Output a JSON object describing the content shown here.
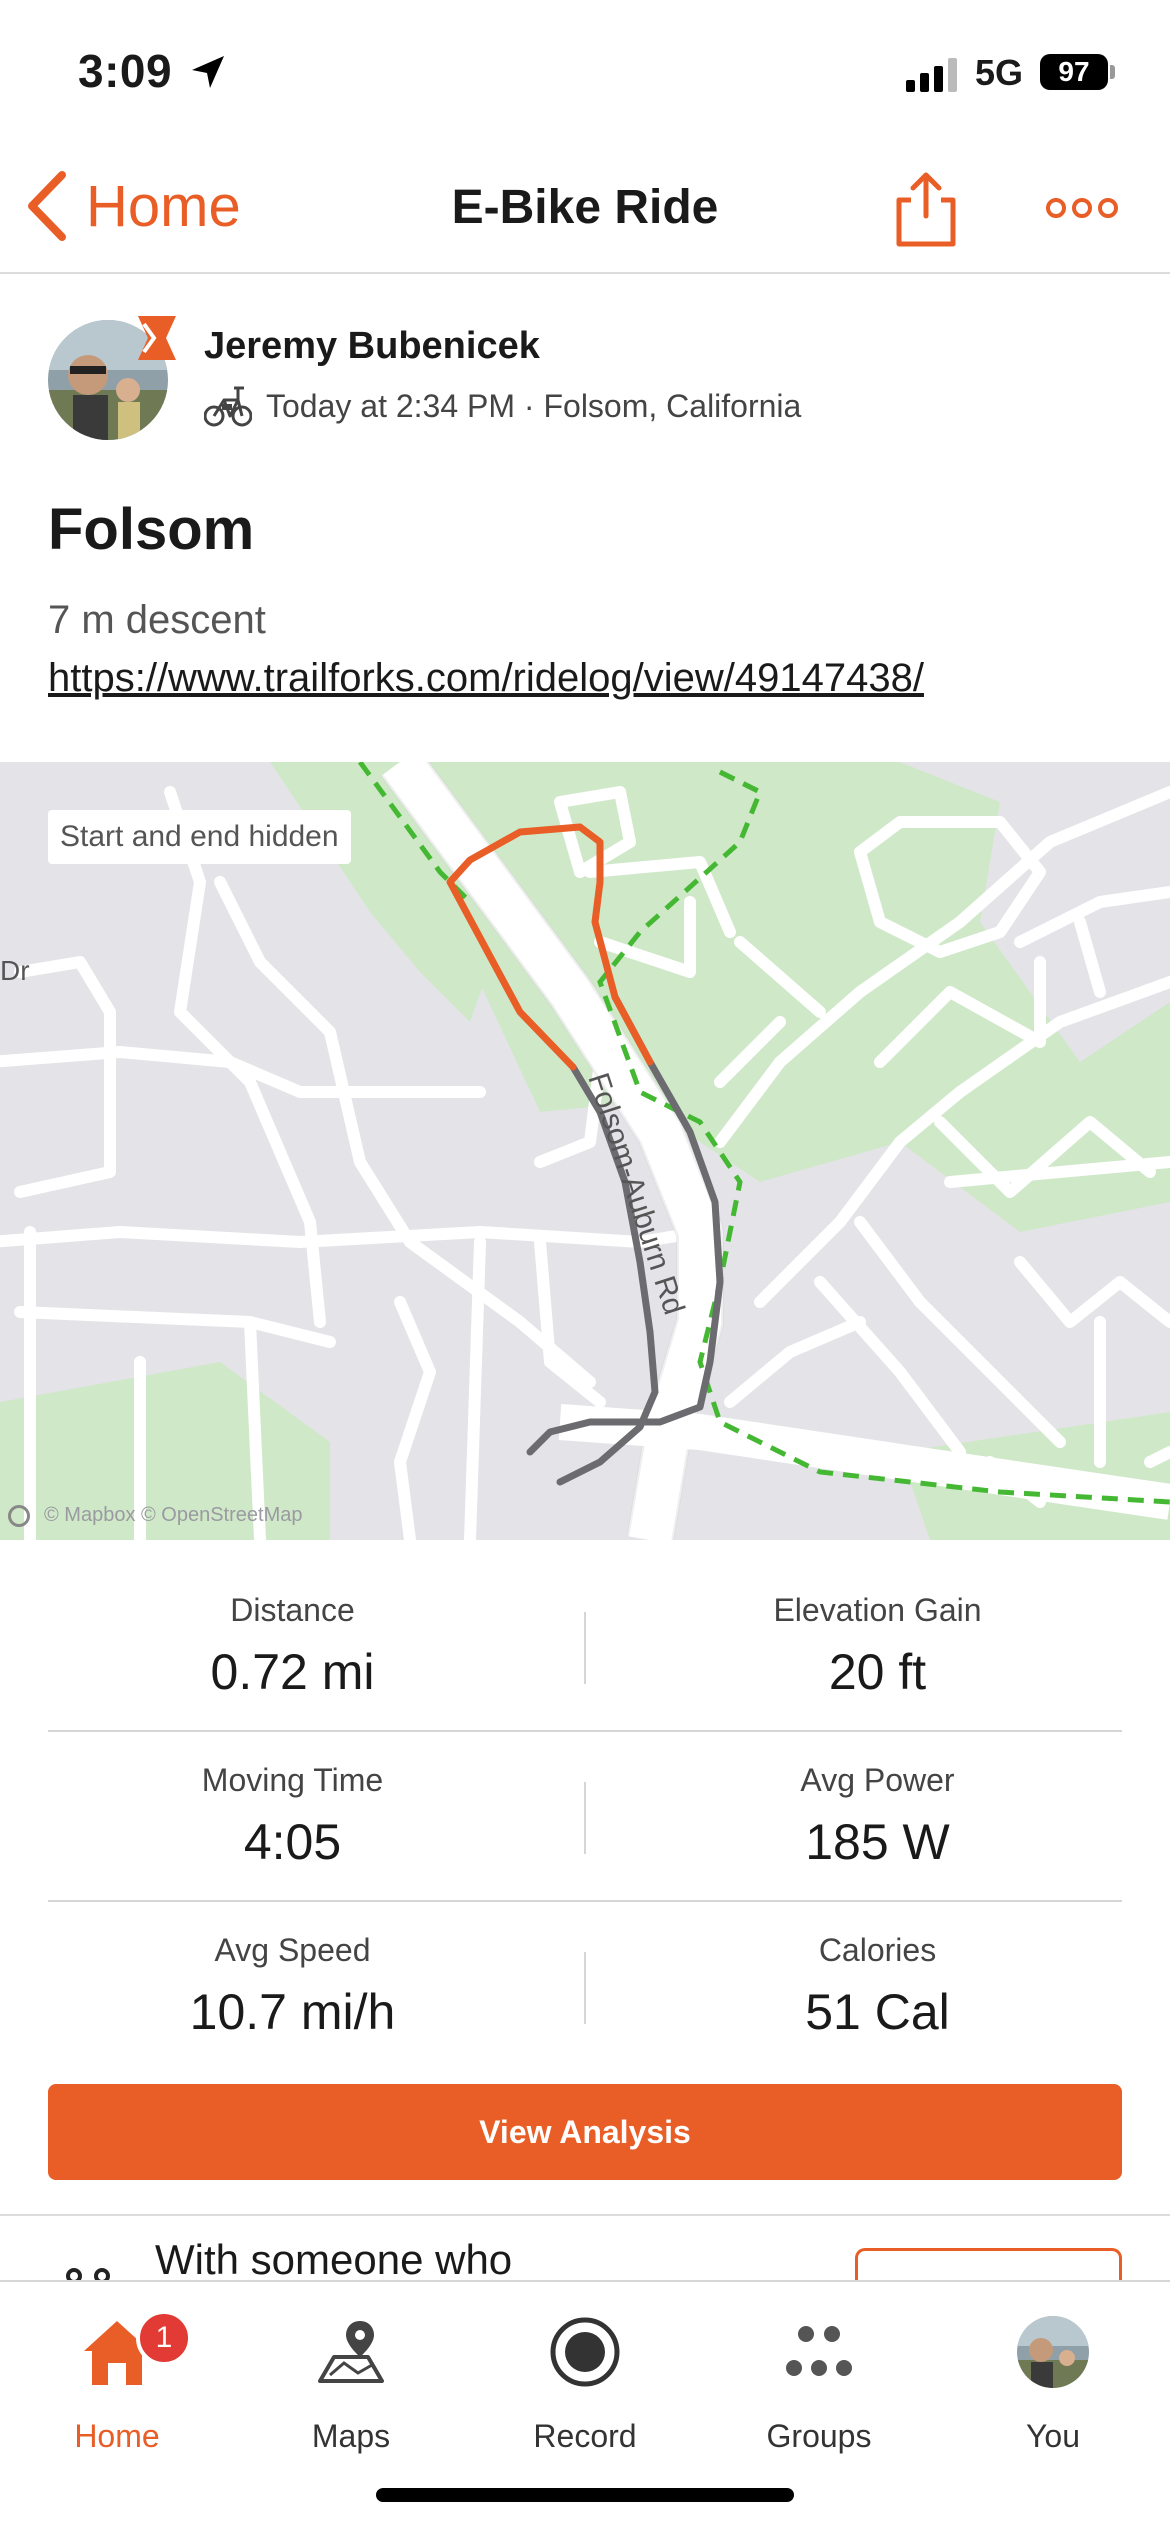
{
  "status_bar": {
    "time": "3:09",
    "network": "5G",
    "battery": "97"
  },
  "header": {
    "back_label": "Home",
    "title": "E-Bike Ride"
  },
  "athlete": {
    "name": "Jeremy Bubenicek",
    "meta": "Today at 2:34 PM · Folsom, California"
  },
  "activity": {
    "title": "Folsom",
    "description": "7 m descent",
    "link": "https://www.trailforks.com/ridelog/view/49147438/"
  },
  "map": {
    "privacy_chip": "Start and end hidden",
    "street_label": "Folsom-Auburn Rd",
    "street_label_left": "Dr",
    "attribution": "© Mapbox © OpenStreetMap"
  },
  "stats": [
    {
      "label": "Distance",
      "value": "0.72 mi"
    },
    {
      "label": "Elevation Gain",
      "value": "20 ft"
    },
    {
      "label": "Moving Time",
      "value": "4:05"
    },
    {
      "label": "Avg Power",
      "value": "185 W"
    },
    {
      "label": "Avg Speed",
      "value": "10.7 mi/h"
    },
    {
      "label": "Calories",
      "value": "51 Cal"
    }
  ],
  "actions": {
    "analysis_label": "View Analysis"
  },
  "partial_card": {
    "text": "With someone who"
  },
  "tabbar": {
    "badge_count": "1",
    "tabs": [
      {
        "label": "Home",
        "icon": "home-icon",
        "active": true
      },
      {
        "label": "Maps",
        "icon": "maps-icon",
        "active": false
      },
      {
        "label": "Record",
        "icon": "record-icon",
        "active": false
      },
      {
        "label": "Groups",
        "icon": "groups-icon",
        "active": false
      },
      {
        "label": "You",
        "icon": "profile-avatar",
        "active": false
      }
    ]
  },
  "colors": {
    "accent": "#e95d26",
    "route_gray": "#6b6b70",
    "park_green": "#cfe8c8",
    "trail_green": "#45b833",
    "badge_red": "#e23a35"
  }
}
